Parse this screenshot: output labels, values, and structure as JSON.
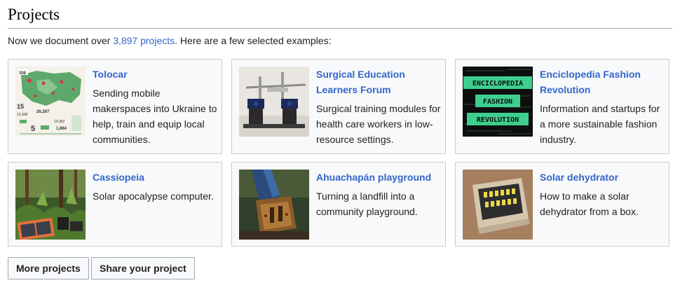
{
  "heading": "Projects",
  "intro": {
    "prefix": "Now we document over ",
    "link": "3,897 projects",
    "suffix": ". Here are a few selected examples:"
  },
  "colors": {
    "link": "#3366cc",
    "card_bg": "#f8f9fa",
    "card_border": "#c8ccd1",
    "rule": "#a2a9b1"
  },
  "cards": [
    {
      "title": "Tolocar",
      "description": "Sending mobile makerspaces into Ukraine to help, train and equip local communities.",
      "thumbnail": "infographic-map-image",
      "thumb_text": {
        "n1": "308",
        "n2": "15",
        "n3": "12,608",
        "n4": "26,267",
        "n5": "14,952",
        "n6": "1,864",
        "n7": "5"
      }
    },
    {
      "title": "Surgical Education Learners Forum",
      "description": "Surgical training modules for health care workers in low-resource settings.",
      "thumbnail": "surgical-training-rig-image"
    },
    {
      "title": "Enciclopedia Fashion Revolution",
      "description": "Information and startups for a more sustainable fashion industry.",
      "thumbnail": "fashion-revolution-code-image",
      "thumb_text": {
        "line1": "ENCICLOPEDIA",
        "line2": "FASHION",
        "line3": "REVOLUTION"
      }
    },
    {
      "title": "Cassiopeia",
      "description": "Solar apocalypse computer.",
      "thumbnail": "forest-solar-panel-image"
    },
    {
      "title": "Ahuachapán playground",
      "description": "Turning a landfill into a community playground.",
      "thumbnail": "rusty-metal-bracket-image"
    },
    {
      "title": "Solar dehydrator",
      "description": "How to make a solar dehydrator from a box.",
      "thumbnail": "solar-dehydrator-box-image"
    }
  ],
  "buttons": {
    "more": "More projects",
    "share": "Share your project"
  }
}
